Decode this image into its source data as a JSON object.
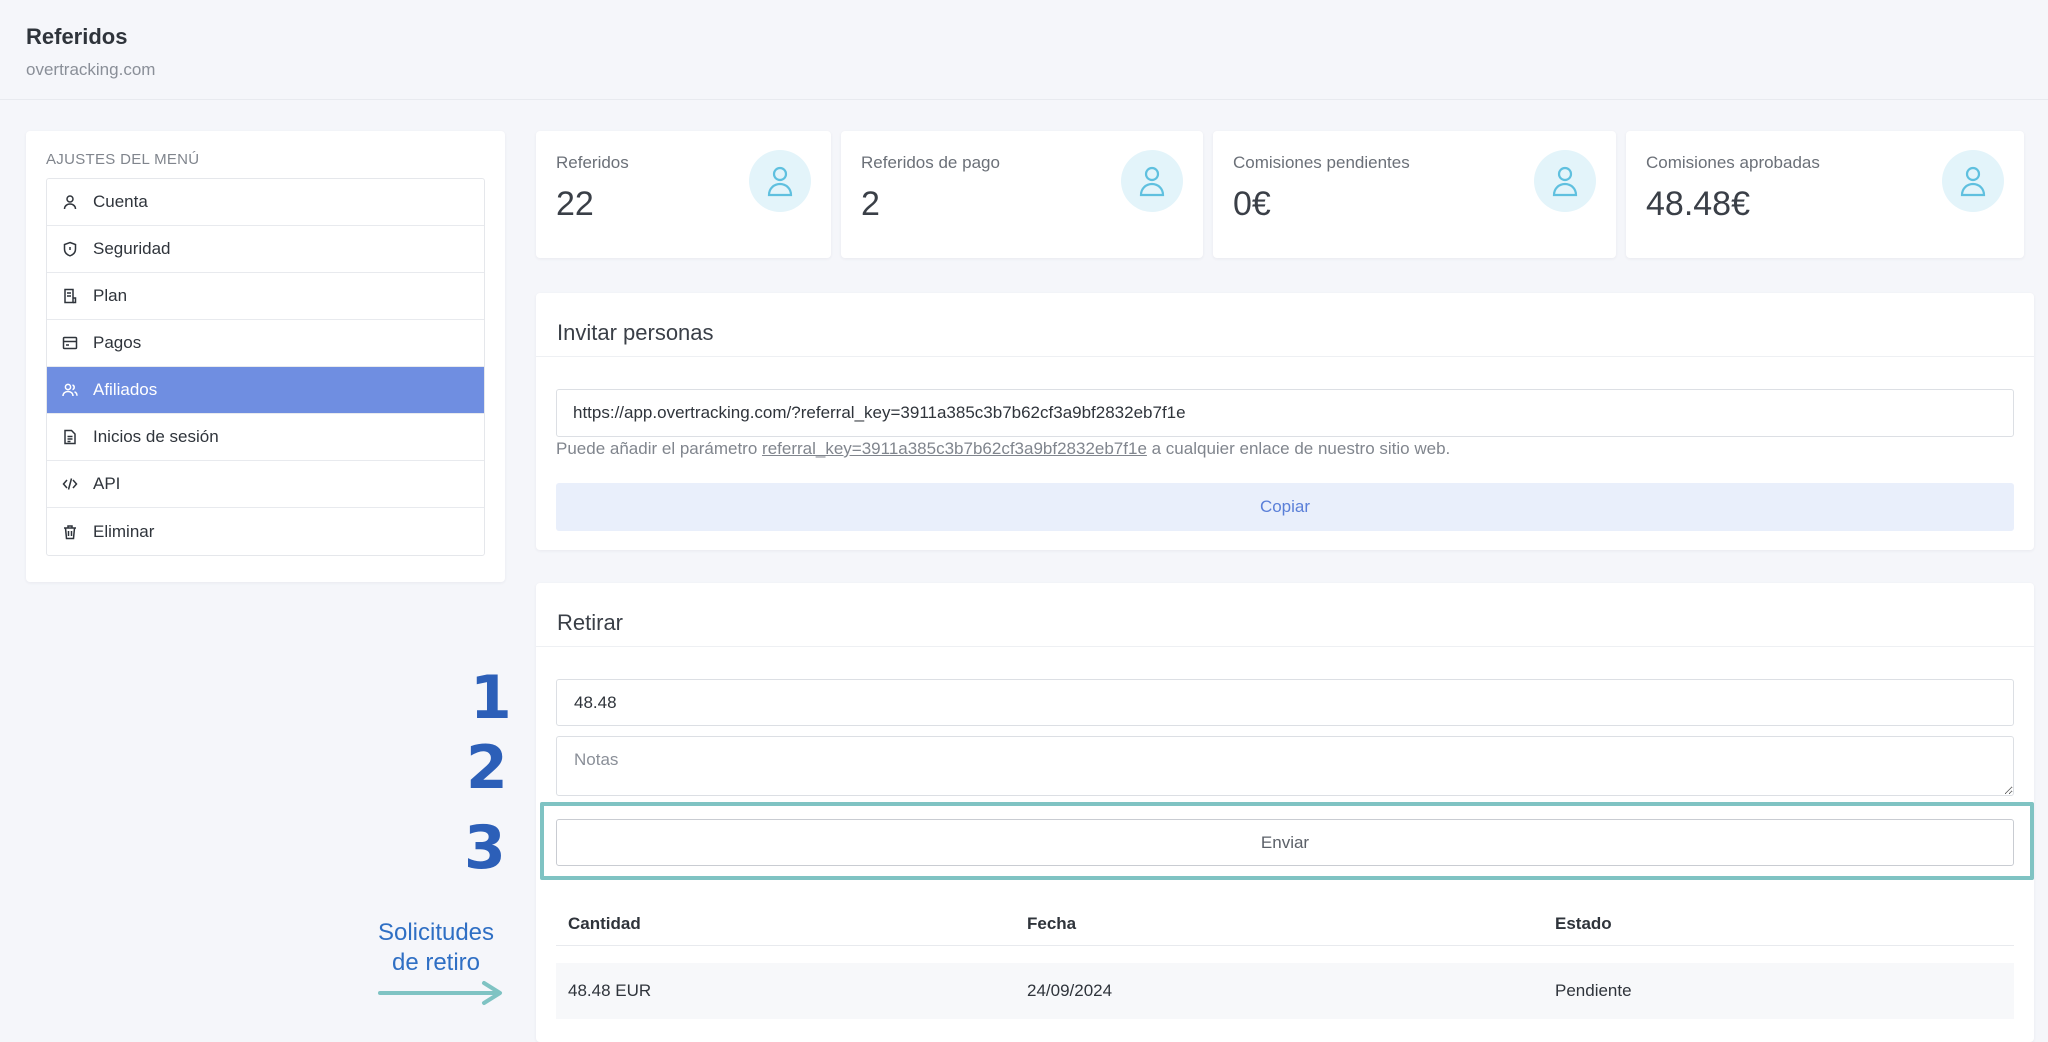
{
  "header": {
    "title": "Referidos",
    "subtitle": "overtracking.com"
  },
  "menu": {
    "heading": "AJUSTES DEL MENÚ",
    "items": [
      {
        "label": "Cuenta",
        "icon": "user-icon",
        "active": false
      },
      {
        "label": "Seguridad",
        "icon": "shield-icon",
        "active": false
      },
      {
        "label": "Plan",
        "icon": "receipt-icon",
        "active": false
      },
      {
        "label": "Pagos",
        "icon": "credit-card-icon",
        "active": false
      },
      {
        "label": "Afiliados",
        "icon": "users-icon",
        "active": true
      },
      {
        "label": "Inicios de sesión",
        "icon": "document-icon",
        "active": false
      },
      {
        "label": "API",
        "icon": "code-icon",
        "active": false
      },
      {
        "label": "Eliminar",
        "icon": "trash-icon",
        "active": false
      }
    ]
  },
  "stats": [
    {
      "label": "Referidos",
      "value": "22",
      "icon": "user-icon"
    },
    {
      "label": "Referidos de pago",
      "value": "2",
      "icon": "user-icon"
    },
    {
      "label": "Comisiones pendientes",
      "value": "0€",
      "icon": "user-icon"
    },
    {
      "label": "Comisiones aprobadas",
      "value": "48.48€",
      "icon": "user-icon"
    }
  ],
  "invite": {
    "title": "Invitar personas",
    "url": "https://app.overtracking.com/?referral_key=3911a385c3b7b62cf3a9bf2832eb7f1e",
    "helper_before": "Puede añadir el parámetro ",
    "helper_param": "referral_key=3911a385c3b7b62cf3a9bf2832eb7f1e",
    "helper_after": " a cualquier enlace de nuestro sitio web.",
    "copy_label": "Copiar"
  },
  "withdraw": {
    "title": "Retirar",
    "amount_value": "48.48",
    "notes_placeholder": "Notas",
    "send_label": "Enviar",
    "table": {
      "headers": [
        "Cantidad",
        "Fecha",
        "Estado"
      ],
      "rows": [
        [
          "48.48 EUR",
          "24/09/2024",
          "Pendiente"
        ]
      ]
    }
  },
  "annotations": {
    "steps": [
      "1",
      "2",
      "3"
    ],
    "label_line1": "Solicitudes",
    "label_line2": "de retiro",
    "accent_color": "#2c5fb8",
    "highlight_color": "#7fc3c3"
  },
  "colors": {
    "active_menu": "#6f8ee1",
    "avatar_bg": "#e3f4fa",
    "avatar_icon": "#5fc0df",
    "copy_bg": "#e9effb"
  }
}
